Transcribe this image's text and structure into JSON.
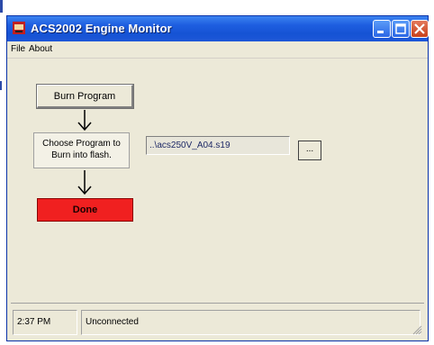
{
  "window": {
    "title": "ACS2002 Engine Monitor"
  },
  "menu": {
    "items": [
      "File",
      "About"
    ]
  },
  "flow": {
    "burn_button": "Burn Program",
    "choose_text": "Choose Program to Burn into flash.",
    "done_button": "Done"
  },
  "program_file": {
    "path": "..\\acs250V_A04.s19",
    "browse_label": "..."
  },
  "status": {
    "time": "2:37 PM",
    "connection": "Unconnected"
  },
  "colors": {
    "titlebar": "#1553d4",
    "done": "#f02020",
    "window_face": "#ece9d8"
  },
  "icons": {
    "app": "app-icon",
    "minimize": "minimize-icon",
    "maximize": "maximize-icon",
    "close": "close-icon",
    "arrows": "arrow-down-icon",
    "grip": "resize-grip-icon"
  }
}
